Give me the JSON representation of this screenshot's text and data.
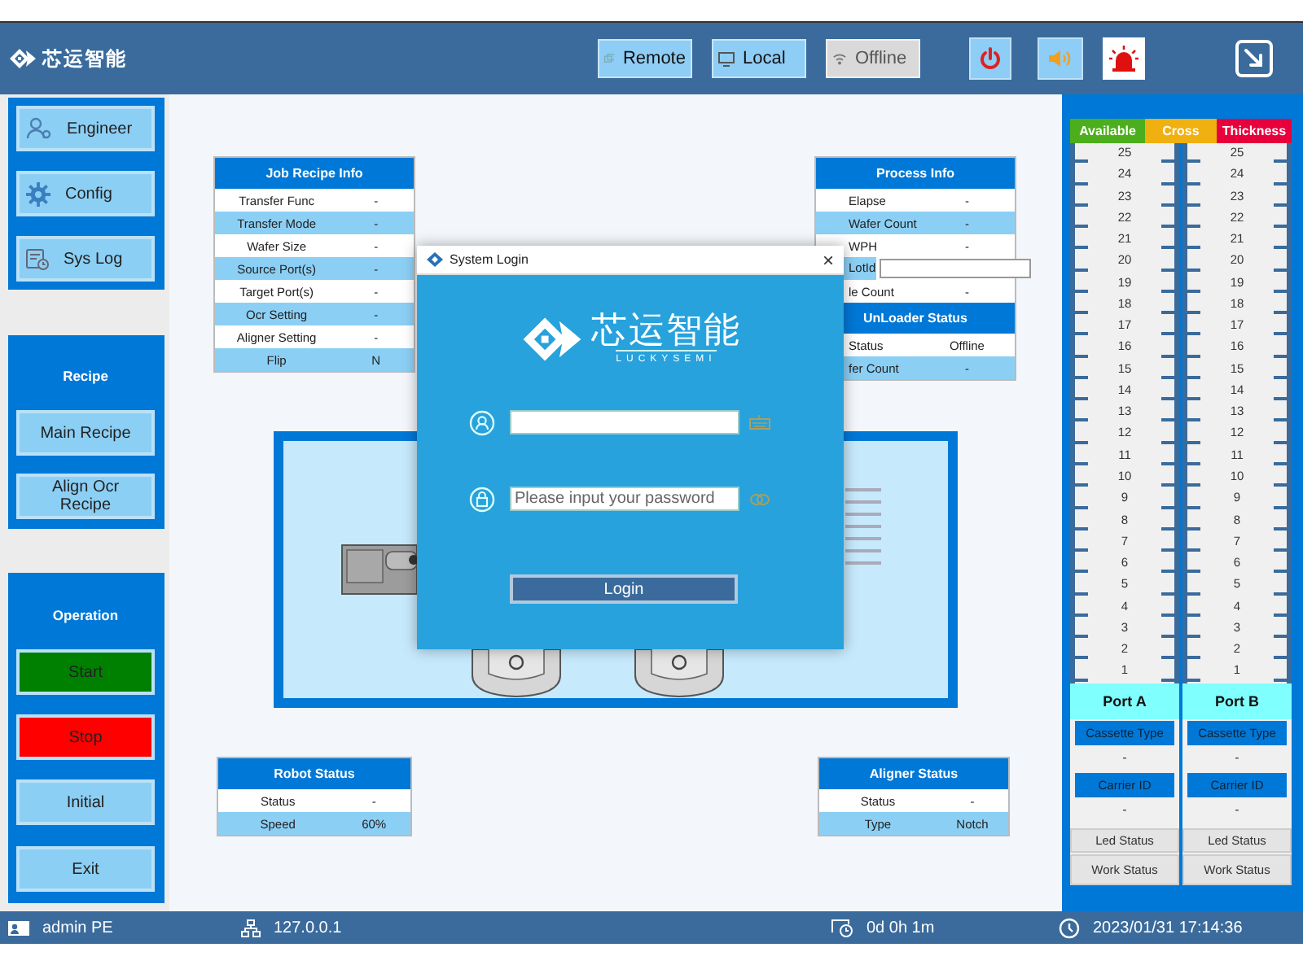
{
  "header": {
    "logo": "芯运智能",
    "modes": [
      {
        "kind": "remote",
        "label": "Remote",
        "enabled": true
      },
      {
        "kind": "local",
        "label": "Local",
        "enabled": true
      },
      {
        "kind": "offline",
        "label": "Offline",
        "enabled": false
      }
    ]
  },
  "sidebar": {
    "panels": [
      {
        "buttons": [
          {
            "label": "Engineer",
            "kind": "user"
          },
          {
            "label": "Config",
            "kind": "gear"
          },
          {
            "label": "Sys Log",
            "kind": "log"
          }
        ]
      },
      {
        "title": "Recipe",
        "buttons": [
          {
            "label": "Main Recipe"
          },
          {
            "label": "Align Ocr Recipe"
          }
        ]
      },
      {
        "title": "Operation",
        "buttons": [
          {
            "label": "Start",
            "color": "#008000"
          },
          {
            "label": "Stop",
            "color": "#ff0000"
          },
          {
            "label": "Initial",
            "color": "#8ccff5"
          },
          {
            "label": "Exit",
            "color": "#8ccff5"
          }
        ]
      }
    ]
  },
  "canvas": {
    "info_panels": [
      {
        "title": "Job Recipe Info",
        "rows": [
          {
            "label": "Transfer Func",
            "value": "-"
          },
          {
            "label": "Transfer Mode",
            "value": "-"
          },
          {
            "label": "Wafer Size",
            "value": "-"
          },
          {
            "label": "Source Port(s)",
            "value": "-"
          },
          {
            "label": "Target Port(s)",
            "value": "-"
          },
          {
            "label": "Ocr Setting",
            "value": "-"
          },
          {
            "label": "Aligner Setting",
            "value": "-"
          },
          {
            "label": "Flip",
            "value": "N"
          }
        ]
      },
      {
        "title": "Process Info",
        "rows": [
          {
            "kind": "text",
            "label": "Elapse",
            "value": "-"
          },
          {
            "kind": "text",
            "label": "Wafer Count",
            "value": "-"
          },
          {
            "kind": "text",
            "label": "WPH",
            "value": "-"
          },
          {
            "kind": "field",
            "label": "LotId"
          },
          {
            "kind": "text",
            "label": "le  Count",
            "value": "-"
          }
        ],
        "section": {
          "title": "UnLoader Status",
          "rows": [
            {
              "label": "Status",
              "value": "Offline"
            },
            {
              "label": "fer Count",
              "value": "-"
            }
          ]
        }
      },
      {
        "title": "Robot Status",
        "rows": [
          {
            "label": "Status",
            "value": "-"
          },
          {
            "label": "Speed",
            "value": "60%"
          }
        ]
      },
      {
        "title": "Aligner Status",
        "rows": [
          {
            "label": "Status",
            "value": "-"
          },
          {
            "label": "Type",
            "value": "Notch"
          }
        ]
      }
    ],
    "login_dialog": {
      "title": "System Login",
      "close": "×",
      "brand": "芯运智能",
      "brand_sub": "LUCKYSEMI",
      "password_placeholder": "Please input your password",
      "login_button": "Login"
    }
  },
  "ports": {
    "legend": [
      {
        "label": "Available",
        "color": "#4cae1c"
      },
      {
        "label": "Cross",
        "color": "#f0b00f"
      },
      {
        "label": "Thickness",
        "color": "#e8003c"
      }
    ],
    "columns": [
      {
        "name": "Port A",
        "slots": [
          "25",
          "24",
          "23",
          "22",
          "21",
          "20",
          "19",
          "18",
          "17",
          "16",
          "15",
          "14",
          "13",
          "12",
          "11",
          "10",
          "9",
          "8",
          "7",
          "6",
          "5",
          "4",
          "3",
          "2",
          "1"
        ],
        "fields": [
          {
            "label": "Cassette Type",
            "value": "-"
          },
          {
            "label": "Carrier ID",
            "value": "-"
          }
        ],
        "buttons": [
          "Led Status",
          "Work Status"
        ]
      },
      {
        "name": "Port B",
        "slots": [
          "25",
          "24",
          "23",
          "22",
          "21",
          "20",
          "19",
          "18",
          "17",
          "16",
          "15",
          "14",
          "13",
          "12",
          "11",
          "10",
          "9",
          "8",
          "7",
          "6",
          "5",
          "4",
          "3",
          "2",
          "1"
        ],
        "fields": [
          {
            "label": "Cassette Type",
            "value": "-"
          },
          {
            "label": "Carrier ID",
            "value": "-"
          }
        ],
        "buttons": [
          "Led Status",
          "Work Status"
        ]
      }
    ]
  },
  "status_bar": [
    {
      "kind": "user",
      "text": "admin PE"
    },
    {
      "kind": "network",
      "text": "127.0.0.1"
    },
    {
      "kind": "timer",
      "text": "0d 0h 1m"
    },
    {
      "kind": "clock",
      "text": "2023/01/31 17:14:36"
    }
  ]
}
